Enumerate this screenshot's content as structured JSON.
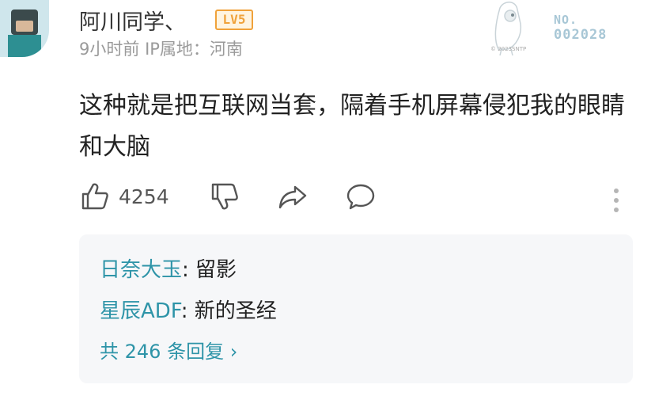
{
  "user": {
    "name": "阿川同学、",
    "level": "LV5",
    "time": "9小时前",
    "ip_location": "IP属地：河南"
  },
  "decoration": {
    "no_label": "NO.",
    "number": "002028",
    "footnote": "© 2023SNTP"
  },
  "comment": {
    "text": "这种就是把互联网当套，隔着手机屏幕侵犯我的眼睛和大脑"
  },
  "actions": {
    "like_count": "4254",
    "icons": [
      "thumbs-up-icon",
      "thumbs-down-icon",
      "share-icon",
      "comment-icon",
      "more-vertical-icon"
    ]
  },
  "replies": {
    "items": [
      {
        "name": "日奈大玉",
        "separator": ": ",
        "text": "留影"
      },
      {
        "name": "星辰ADF",
        "separator": ": ",
        "text": "新的圣经"
      }
    ],
    "more_label": "共 246 条回复 ›"
  },
  "colors": {
    "accent": "#2e94a8",
    "level_badge": "#f0a23a",
    "meta_gray": "#9a9a9a",
    "reply_bg": "#f6f7f9"
  }
}
